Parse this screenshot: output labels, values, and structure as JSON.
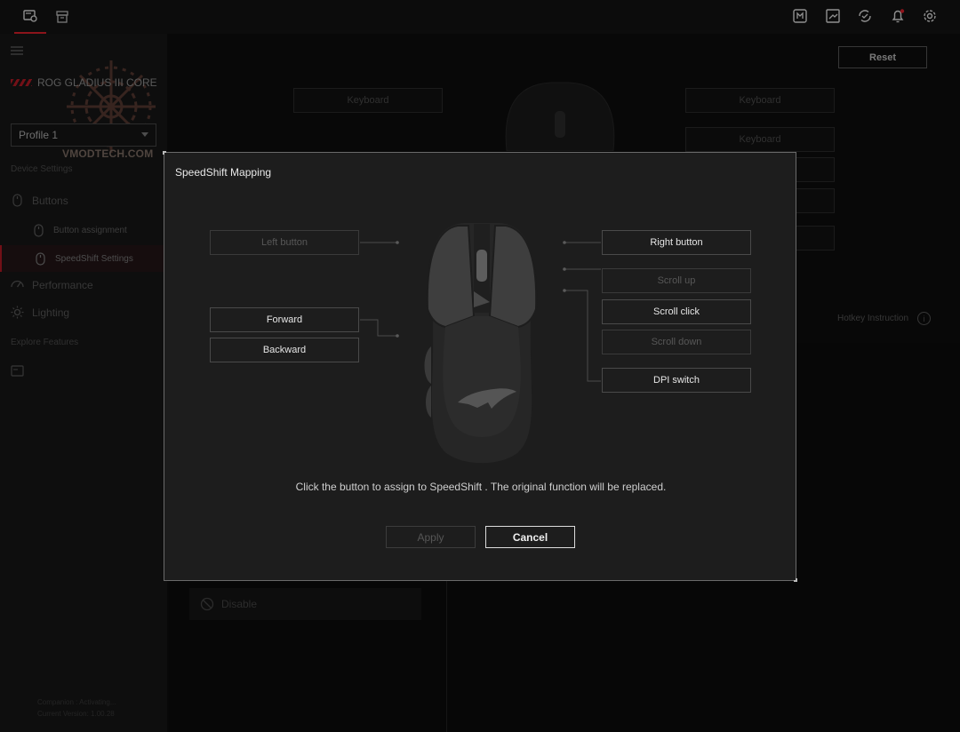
{
  "topbar": {
    "tabs": [
      {
        "icon": "device-icon",
        "active": true
      },
      {
        "icon": "store-icon",
        "active": false
      }
    ],
    "right_icons": [
      "macro-icon",
      "screenshot-icon",
      "sync-icon",
      "bell-icon",
      "gear-icon"
    ],
    "accent": "#d81f2a"
  },
  "sidebar": {
    "device_name": "ROG GLADIUS III CORE",
    "profile": "Profile 1",
    "watermark_text": "VMODTECH.COM",
    "device_settings_title": "Device Settings",
    "items": {
      "buttons": "Buttons",
      "button_assignment": "Button assignment",
      "speedshift_settings": "SpeedShift Settings",
      "performance": "Performance",
      "lighting": "Lighting"
    },
    "explore_title": "Explore Features",
    "companion": "Companion",
    "footer": {
      "status": "Companion : Activating...",
      "version": "Current Version: 1.00.28"
    }
  },
  "background": {
    "reset_label": "Reset",
    "keyboard_labels": [
      "Keyboard",
      "Keyboard",
      "Keyboard"
    ],
    "hotkey_label": "Hotkey Instruction",
    "info_symbol": "i",
    "disable_label": "Disable"
  },
  "modal": {
    "title": "SpeedShift Mapping",
    "buttons": {
      "left": "Left button",
      "forward": "Forward",
      "backward": "Backward",
      "right": "Right button",
      "scroll_up": "Scroll up",
      "scroll_click": "Scroll click",
      "scroll_down": "Scroll down",
      "dpi_switch": "DPI switch"
    },
    "hint": "Click the button to assign to SpeedShift . The original function will be replaced.",
    "apply_label": "Apply",
    "cancel_label": "Cancel"
  }
}
